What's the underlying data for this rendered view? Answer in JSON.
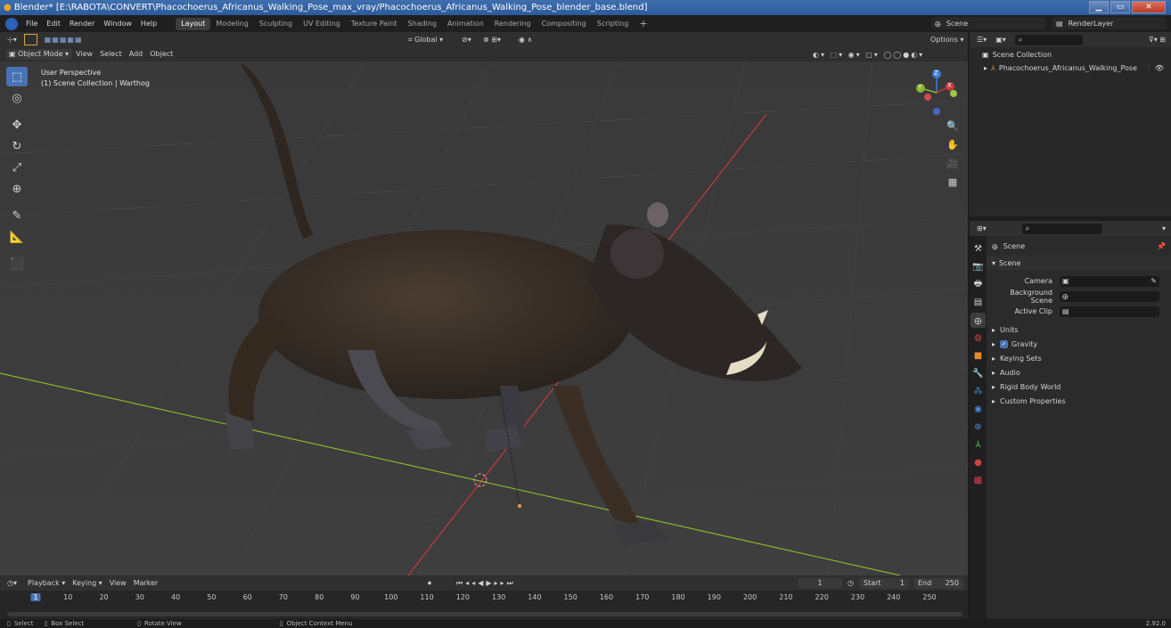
{
  "title": "Blender* [E:\\RABOTA\\CONVERT\\Phacochoerus_Africanus_Walking_Pose_max_vray/Phacochoerus_Africanus_Walking_Pose_blender_base.blend]",
  "window_buttons": [
    "▁",
    "▭",
    "✕"
  ],
  "menu": [
    "File",
    "Edit",
    "Render",
    "Window",
    "Help"
  ],
  "workspaces": [
    "Layout",
    "Modeling",
    "Sculpting",
    "UV Editing",
    "Texture Paint",
    "Shading",
    "Animation",
    "Rendering",
    "Compositing",
    "Scripting"
  ],
  "active_workspace": "Layout",
  "scene_name": "Scene",
  "view_layer": "RenderLayer",
  "viewport": {
    "transform_orientation": "Global",
    "options_label": "Options",
    "mode": "Object Mode",
    "menus": [
      "View",
      "Select",
      "Add",
      "Object"
    ],
    "overlay_line1": "User Perspective",
    "overlay_line2": "(1) Scene Collection | Warthog",
    "gizmo_axes": [
      "X",
      "Y",
      "Z"
    ]
  },
  "outliner": {
    "root": "Scene Collection",
    "items": [
      "Phacochoerus_Africanus_Walking_Pose"
    ]
  },
  "properties": {
    "context": "Scene",
    "panel": "Scene",
    "fields": [
      {
        "label": "Camera",
        "value": ""
      },
      {
        "label": "Background Scene",
        "value": ""
      },
      {
        "label": "Active Clip",
        "value": ""
      }
    ],
    "sections": [
      {
        "label": "Units",
        "checkbox": false
      },
      {
        "label": "Gravity",
        "checkbox": true
      },
      {
        "label": "Keying Sets",
        "checkbox": false
      },
      {
        "label": "Audio",
        "checkbox": false
      },
      {
        "label": "Rigid Body World",
        "checkbox": false
      },
      {
        "label": "Custom Properties",
        "checkbox": false
      }
    ]
  },
  "timeline": {
    "menus": [
      "Playback",
      "Keying",
      "View",
      "Marker"
    ],
    "current_frame": "1",
    "start_label": "Start",
    "start": "1",
    "end_label": "End",
    "end": "250",
    "ticks": [
      "1",
      "10",
      "20",
      "30",
      "40",
      "50",
      "60",
      "70",
      "80",
      "90",
      "100",
      "110",
      "120",
      "130",
      "140",
      "150",
      "160",
      "170",
      "180",
      "190",
      "200",
      "210",
      "220",
      "230",
      "240",
      "250"
    ]
  },
  "statusbar": {
    "items": [
      "Select",
      "Box Select",
      "Rotate View",
      "Object Context Menu"
    ],
    "version": "2.92.0"
  },
  "colors": {
    "accent": "#4772b3",
    "axis_x": "#c8393f",
    "axis_y": "#8ab430",
    "axis_z": "#3d7fd6",
    "titlebar": "#3767a6"
  }
}
